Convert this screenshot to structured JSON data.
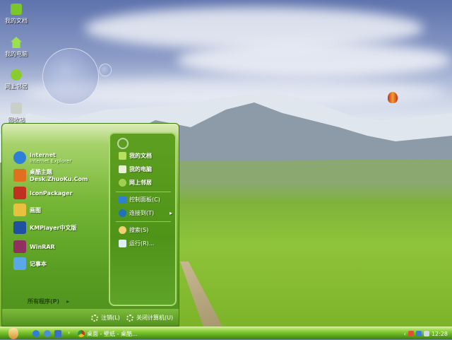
{
  "desktop": {
    "icons": [
      {
        "label": "我的文档",
        "icon": "folder-icon",
        "color": "#7cc62a"
      },
      {
        "label": "我的电脑",
        "icon": "home-computer-icon",
        "color": "#9be04e"
      },
      {
        "label": "网上邻居",
        "icon": "network-globe-icon",
        "color": "#8acc30"
      },
      {
        "label": "回收站",
        "icon": "recycle-bin-icon",
        "color": "#c8d0c8"
      }
    ]
  },
  "start_menu": {
    "pinned": [
      {
        "label": "Internet",
        "sub": "Internet Explorer",
        "icon": "internet-explorer-icon",
        "color": "#2e7fd8"
      },
      {
        "label": "桌酷主题Desk.ZhuoKu.Com",
        "icon": "zhuoku-icon",
        "color": "#e07020"
      },
      {
        "label": "IconPackager",
        "icon": "iconpackager-icon",
        "color": "#c03020"
      },
      {
        "label": "画图",
        "icon": "paint-icon",
        "color": "#e8c040"
      },
      {
        "label": "KMPlayer中文版",
        "icon": "kmplayer-icon",
        "color": "#2050a0"
      },
      {
        "label": "WinRAR",
        "icon": "winrar-icon",
        "color": "#903060"
      },
      {
        "label": "记事本",
        "icon": "notepad-icon",
        "color": "#5aa8e8"
      }
    ],
    "all_programs": "所有程序(P)",
    "places": [
      {
        "label": "我的文档",
        "icon": "folder-icon",
        "color": "#b8e060",
        "bold": true
      },
      {
        "label": "我的电脑",
        "icon": "computer-icon",
        "color": "#e8f4d0",
        "bold": true
      },
      {
        "label": "网上邻居",
        "icon": "network-icon",
        "color": "#a0d050",
        "bold": true
      },
      {
        "label": "控制面板(C)",
        "icon": "control-panel-icon",
        "color": "#3080d0"
      },
      {
        "label": "连接到(T)",
        "icon": "connect-globe-icon",
        "color": "#2070c0",
        "arrow": "▸"
      },
      {
        "label": "搜索(S)",
        "icon": "search-icon",
        "color": "#f0d070"
      },
      {
        "label": "运行(R)...",
        "icon": "run-icon",
        "color": "#e0eef8"
      }
    ],
    "logoff": "注销(L)",
    "shutdown": "关闭计算机(U)"
  },
  "taskbar": {
    "task": "桌面 - 壁纸 - 桌酷...",
    "clock": "12:28",
    "tray_arrow": "‹",
    "ql_arrow": "›"
  }
}
